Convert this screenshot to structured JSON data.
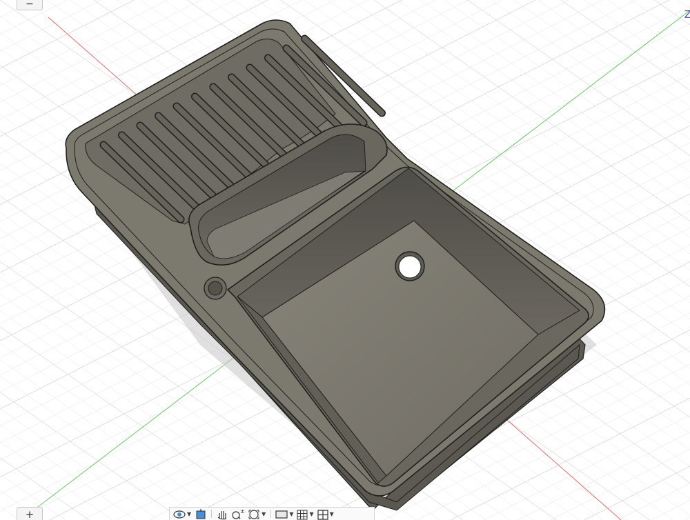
{
  "viewport": {
    "collapse_label": "−",
    "expand_label": "+",
    "axis_label": "Z",
    "colors": {
      "background": "#ffffff",
      "grid_major": "#cfcfcf",
      "grid_minor": "#e6e6e6",
      "axis_x": "#e06060",
      "axis_y": "#60c060",
      "model_body": "#77746b",
      "model_edge": "#1e1e1c"
    }
  },
  "toolbar": {
    "items": [
      {
        "icon": "orbit-icon",
        "has_menu": true
      },
      {
        "icon": "look-at-icon",
        "has_menu": false
      },
      {
        "icon": "pan-icon",
        "has_menu": false
      },
      {
        "icon": "zoom-icon",
        "has_menu": false
      },
      {
        "icon": "fit-icon",
        "has_menu": true
      },
      {
        "icon": "display-settings-icon",
        "has_menu": true
      },
      {
        "icon": "grid-settings-icon",
        "has_menu": true
      },
      {
        "icon": "viewports-icon",
        "has_menu": true
      }
    ]
  }
}
